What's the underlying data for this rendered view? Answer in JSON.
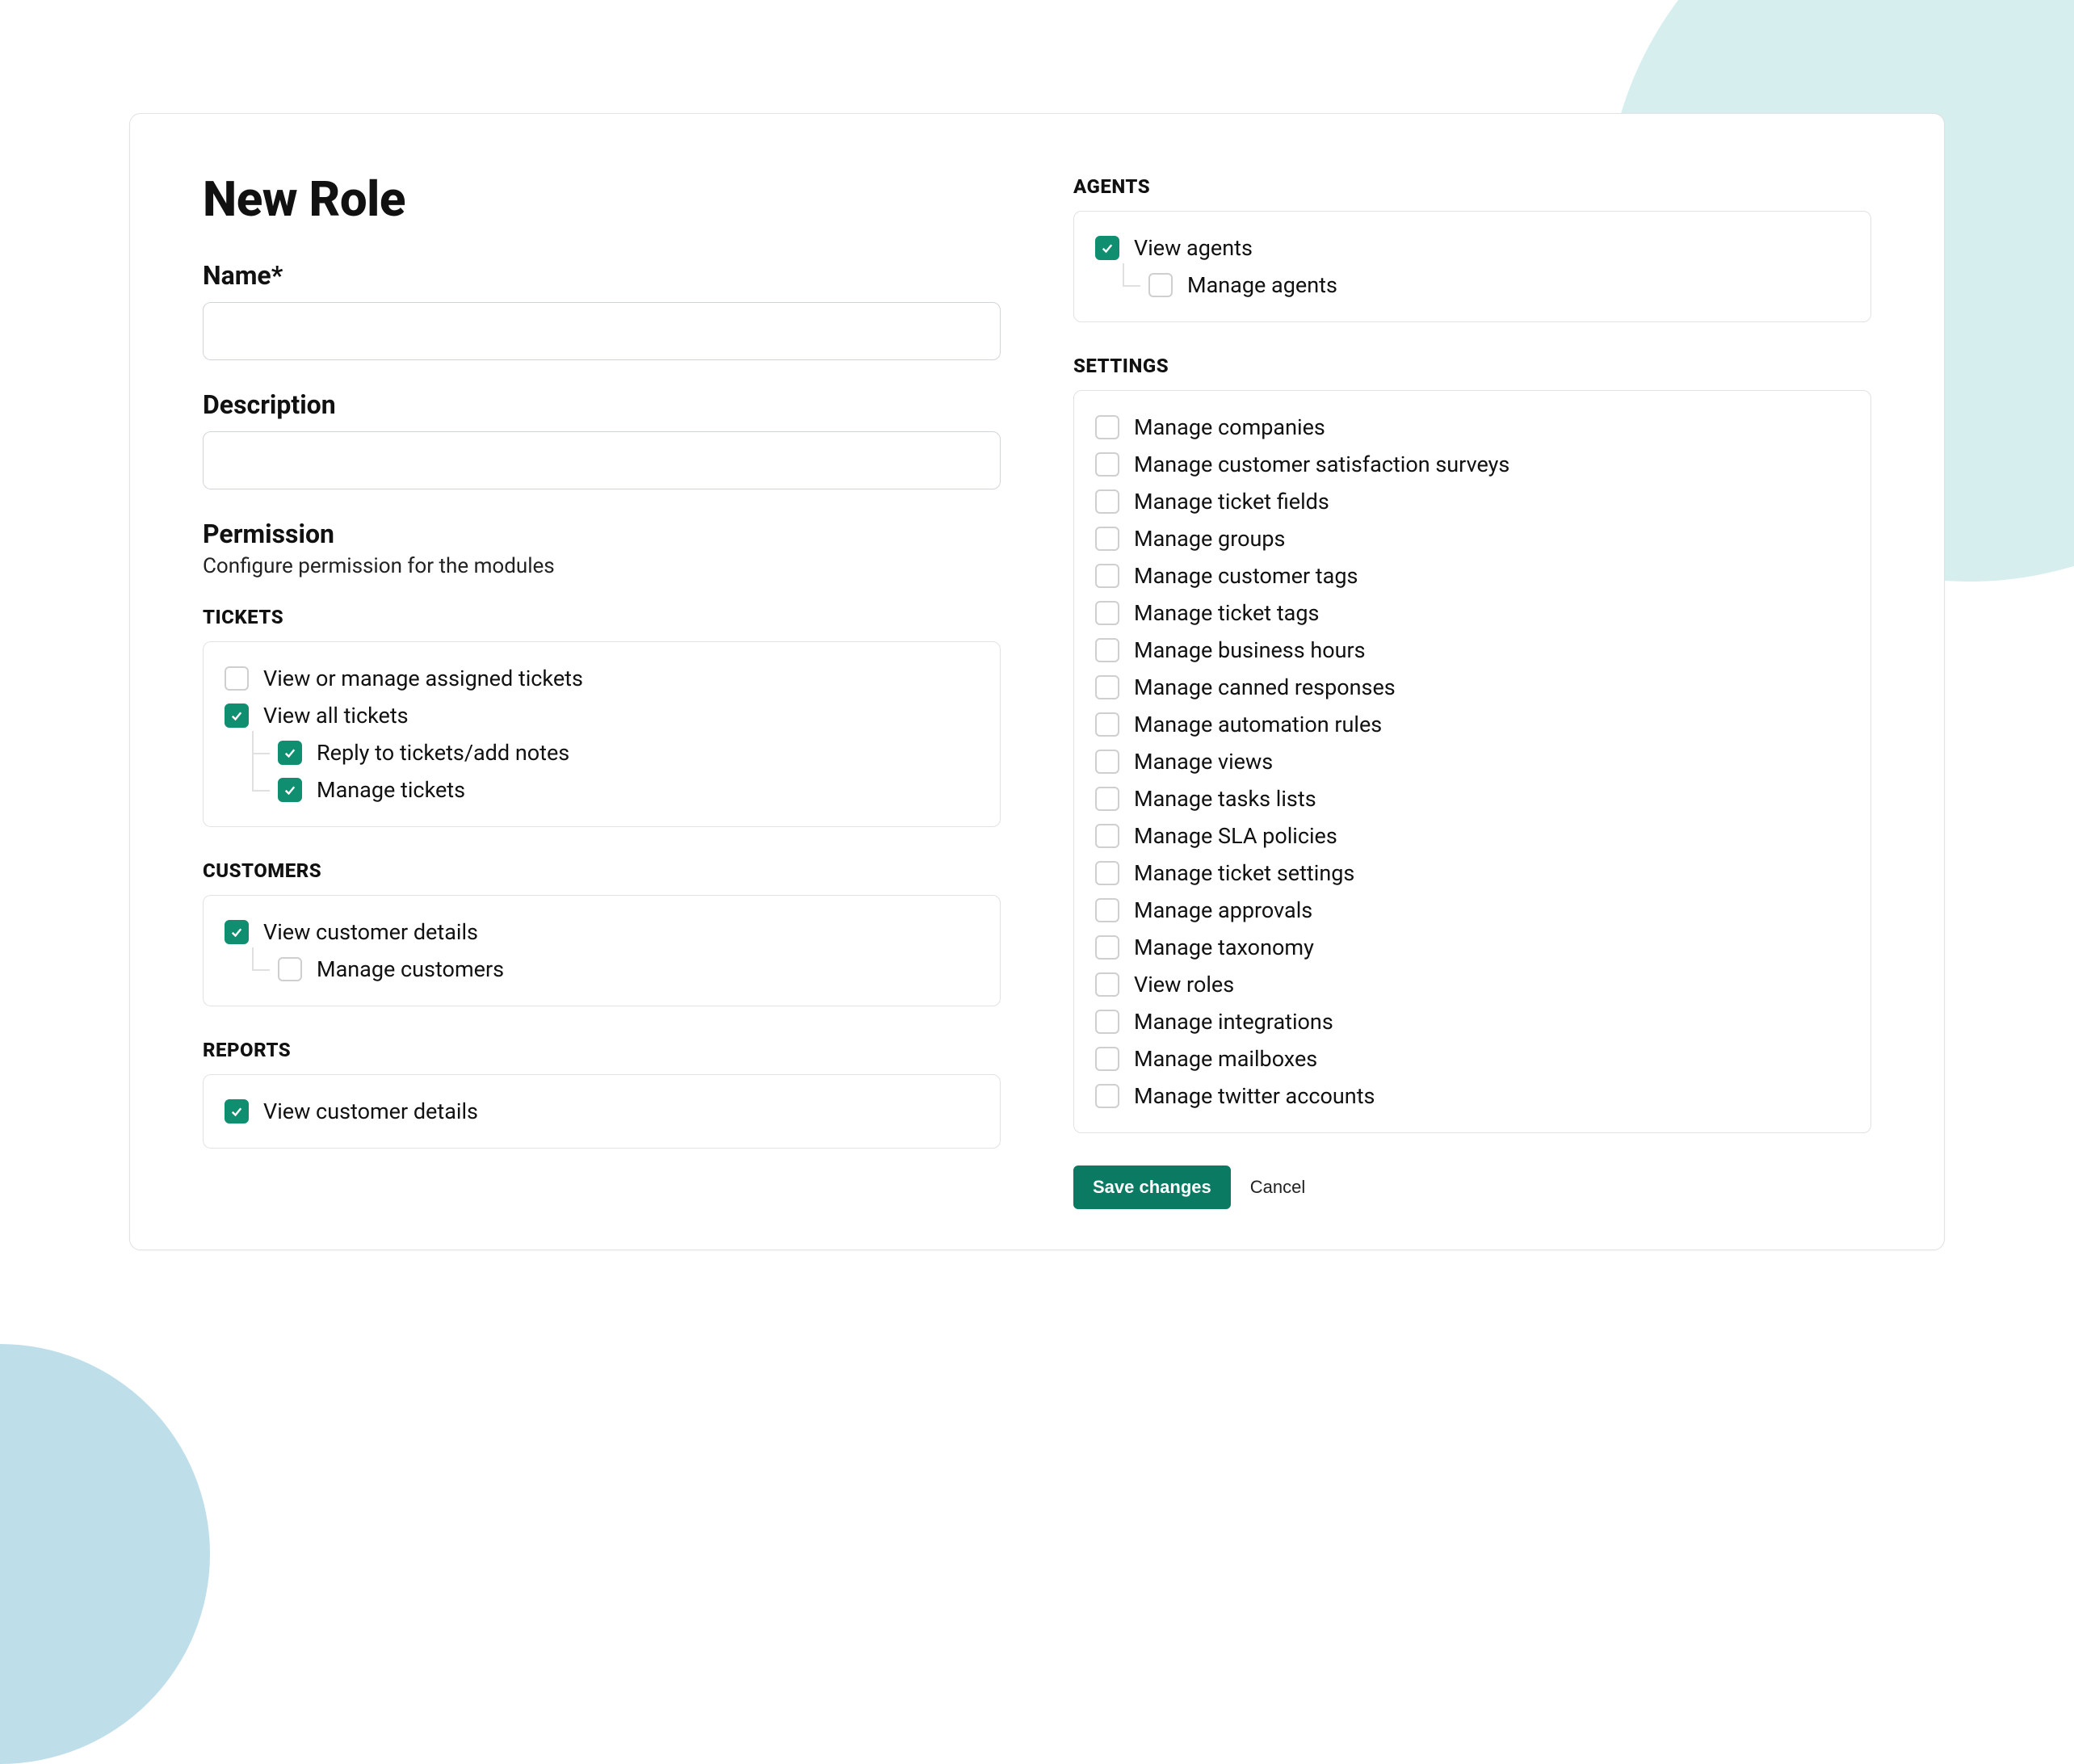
{
  "page": {
    "title": "New Role",
    "name_label": "Name*",
    "description_label": "Description",
    "permission_title": "Permission",
    "permission_sub": "Configure permission for the modules"
  },
  "groups": {
    "tickets": {
      "heading": "TICKETS",
      "items": [
        {
          "label": "View or manage assigned tickets",
          "checked": false
        },
        {
          "label": "View all tickets",
          "checked": true,
          "children": [
            {
              "label": "Reply to tickets/add notes",
              "checked": true
            },
            {
              "label": "Manage tickets",
              "checked": true
            }
          ]
        }
      ]
    },
    "customers": {
      "heading": "CUSTOMERS",
      "items": [
        {
          "label": "View customer details",
          "checked": true,
          "children": [
            {
              "label": "Manage customers",
              "checked": false
            }
          ]
        }
      ]
    },
    "reports": {
      "heading": "REPORTS",
      "items": [
        {
          "label": "View customer details",
          "checked": true
        }
      ]
    },
    "agents": {
      "heading": "AGENTS",
      "items": [
        {
          "label": "View agents",
          "checked": true,
          "children": [
            {
              "label": "Manage agents",
              "checked": false
            }
          ]
        }
      ]
    },
    "settings": {
      "heading": "SETTINGS",
      "items": [
        {
          "label": "Manage companies",
          "checked": false
        },
        {
          "label": "Manage customer satisfaction surveys",
          "checked": false
        },
        {
          "label": "Manage ticket fields",
          "checked": false
        },
        {
          "label": "Manage groups",
          "checked": false
        },
        {
          "label": "Manage customer tags",
          "checked": false
        },
        {
          "label": "Manage ticket tags",
          "checked": false
        },
        {
          "label": "Manage business hours",
          "checked": false
        },
        {
          "label": "Manage canned responses",
          "checked": false
        },
        {
          "label": "Manage automation rules",
          "checked": false
        },
        {
          "label": "Manage views",
          "checked": false
        },
        {
          "label": "Manage tasks lists",
          "checked": false
        },
        {
          "label": "Manage SLA policies",
          "checked": false
        },
        {
          "label": "Manage ticket settings",
          "checked": false
        },
        {
          "label": "Manage approvals",
          "checked": false
        },
        {
          "label": "Manage taxonomy",
          "checked": false
        },
        {
          "label": "View roles",
          "checked": false
        },
        {
          "label": "Manage integrations",
          "checked": false
        },
        {
          "label": "Manage mailboxes",
          "checked": false
        },
        {
          "label": "Manage twitter accounts",
          "checked": false
        }
      ]
    }
  },
  "actions": {
    "save": "Save changes",
    "cancel": "Cancel"
  },
  "form": {
    "name_value": "",
    "description_value": ""
  }
}
